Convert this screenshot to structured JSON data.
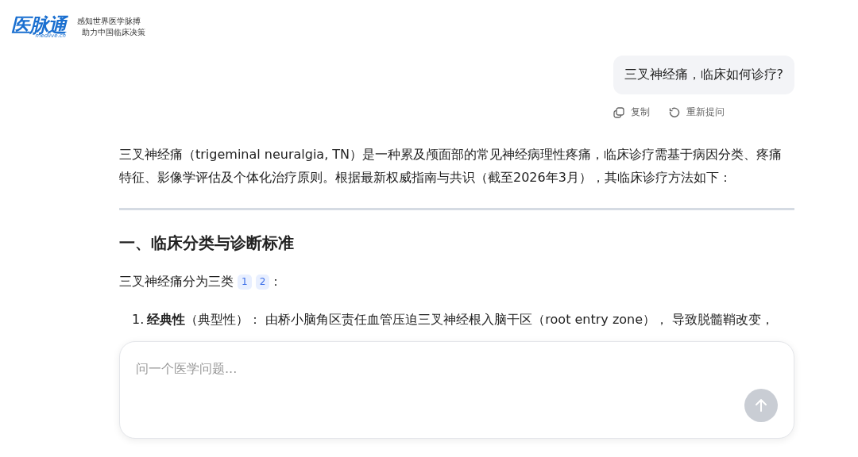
{
  "header": {
    "logo": {
      "name": "医脉通",
      "domain": "medlive.cn"
    },
    "slogans": [
      "感知世界医学脉搏",
      "助力中国临床决策"
    ]
  },
  "question": {
    "text": "三叉神经痛，临床如何诊疗?",
    "actions": [
      {
        "kind": "copy",
        "label": "复制"
      },
      {
        "kind": "retry",
        "label": "重新提问"
      }
    ]
  },
  "answer": {
    "intro": "三叉神经痛（trigeminal neuralgia, TN）是一种累及颅面部的常见神经病理性疼痛，临床诊疗需基于病因分类、疼痛特征、影像学评估及个体化治疗原则。根据最新权威指南与共识（截至2026年3月），其临床诊疗方法如下：",
    "sections": [
      {
        "heading": "一、临床分类与诊断标准",
        "lead": "三叉神经痛分为三类",
        "lead_refs": [
          "1",
          "2"
        ],
        "lead_end": "：",
        "items": [
          {
            "number": "1.",
            "text": "**经典性**（典型性）： 由桥小脑角区责任血管压迫三叉神经根入脑干区（root entry zone）， 导致脱髓鞘改变，"
          }
        ]
      }
    ]
  },
  "composer": {
    "placeholder": "问一个医学问题...",
    "send_disabled": true
  }
}
